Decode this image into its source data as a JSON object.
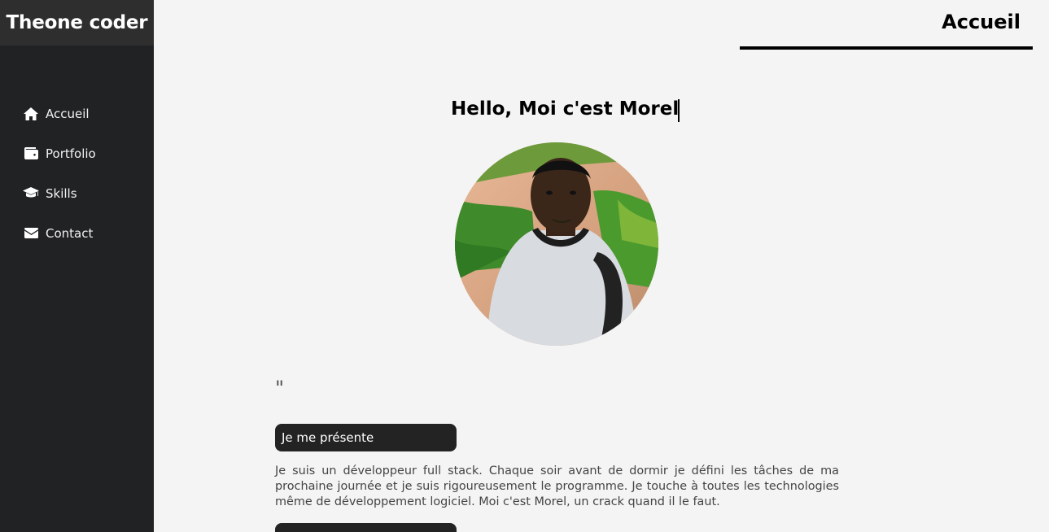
{
  "brand": "Theone coder",
  "nav": [
    {
      "label": "Accueil",
      "icon": "home-icon"
    },
    {
      "label": "Portfolio",
      "icon": "wallet-icon"
    },
    {
      "label": "Skills",
      "icon": "graduation-cap-icon"
    },
    {
      "label": "Contact",
      "icon": "envelope-icon"
    }
  ],
  "header": {
    "section_title": "Accueil"
  },
  "hero": {
    "greeting": "Hello, Moi c'est Morel",
    "quote_mark": "\"",
    "present_button": "Je me présente",
    "bio": "Je suis un développeur full stack. Chaque soir avant de dormir je défini les tâches de ma prochaine journée et je suis rigoureusement le programme. Je touche à toutes les technologies même de développement logiciel. Moi c'est Morel, un crack quand il le faut."
  },
  "colors": {
    "sidebar_bg": "#212224",
    "brand_bg": "#2e2e2e",
    "page_bg": "#f4f4f4",
    "button_bg": "#232323"
  }
}
